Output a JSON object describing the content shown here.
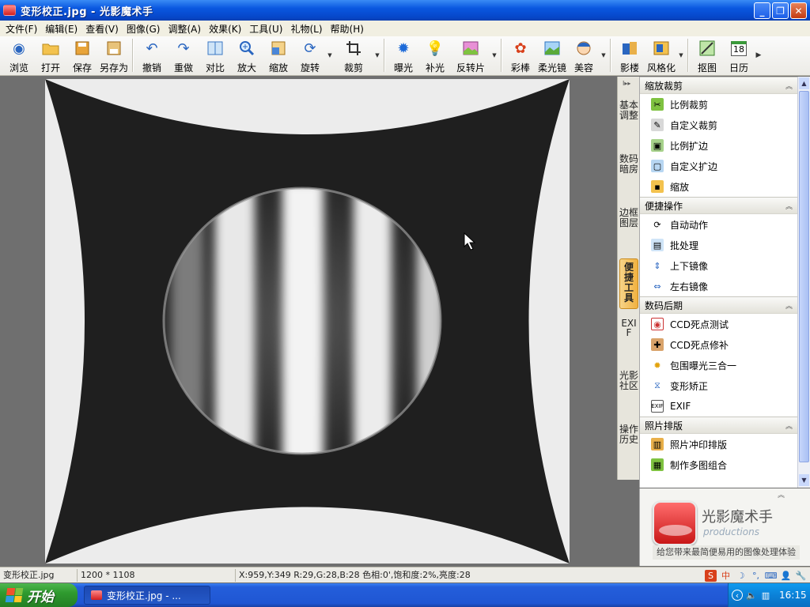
{
  "window": {
    "title": "变形校正.jpg - 光影魔术手",
    "controls": {
      "minimize": "_",
      "maximize": "❐",
      "close": "✕"
    }
  },
  "menu": [
    "文件(F)",
    "编辑(E)",
    "查看(V)",
    "图像(G)",
    "调整(A)",
    "效果(K)",
    "工具(U)",
    "礼物(L)",
    "帮助(H)"
  ],
  "toolbar": {
    "browse": "浏览",
    "open": "打开",
    "save": "保存",
    "save_as": "另存为",
    "undo": "撤销",
    "redo": "重做",
    "compare": "对比",
    "zoom_in": "放大",
    "resize": "缩放",
    "rotate": "旋转",
    "crop": "裁剪",
    "exposure": "曝光",
    "fill_light": "补光",
    "reverse_film": "反转片",
    "color_wand": "彩棒",
    "soft_focus": "柔光镜",
    "beauty": "美容",
    "studio": "影楼",
    "stylize": "风格化",
    "cutout": "抠图",
    "calendar": "日历",
    "calendar_day": "18"
  },
  "side_tabs": [
    "基本调整",
    "数码暗房",
    "边框图层",
    "便捷工具",
    "EXIF",
    "光影社区",
    "操作历史"
  ],
  "panel": {
    "sections": [
      {
        "title": "缩放裁剪",
        "items": [
          "比例裁剪",
          "自定义裁剪",
          "比例扩边",
          "自定义扩边",
          "缩放"
        ]
      },
      {
        "title": "便捷操作",
        "items": [
          "自动动作",
          "批处理",
          "上下镜像",
          "左右镜像"
        ]
      },
      {
        "title": "数码后期",
        "items": [
          "CCD死点测试",
          "CCD死点修补",
          "包围曝光三合一",
          "变形矫正",
          "EXIF"
        ]
      },
      {
        "title": "照片排版",
        "items": [
          "照片冲印排版",
          "制作多图组合"
        ]
      }
    ]
  },
  "brand": {
    "name": "光影魔术手",
    "sub": "productions",
    "slogan": "给您带来最简便易用的图像处理体验"
  },
  "status": {
    "filename": "变形校正.jpg",
    "dimensions": "1200 * 1108",
    "pixel_info": "X:959,Y:349 R:29,G:28,B:28 色相:0',饱和度:2%,亮度:28"
  },
  "ime": [
    "S",
    "中",
    "☽",
    "°,",
    "⌨",
    "👤",
    "🔧"
  ],
  "taskbar": {
    "start": "开始",
    "app": "变形校正.jpg - ...",
    "clock": "16:15"
  }
}
